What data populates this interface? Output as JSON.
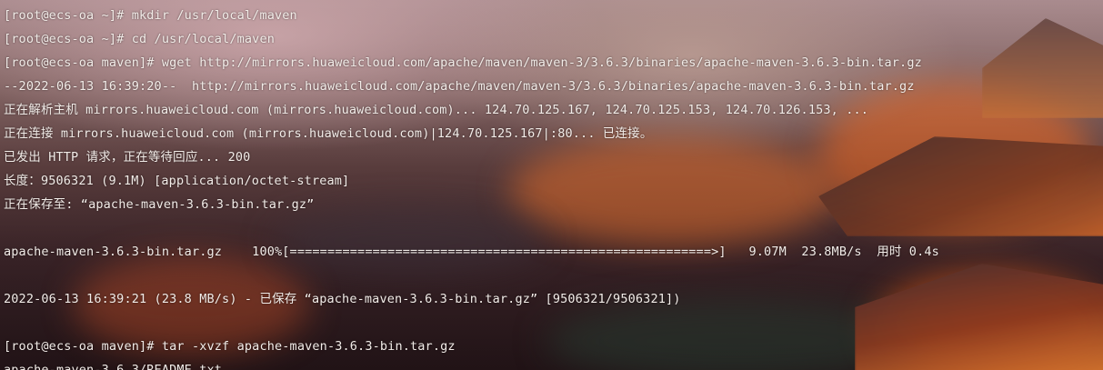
{
  "terminal": {
    "lines": [
      "[root@ecs-oa ~]# mkdir /usr/local/maven",
      "[root@ecs-oa ~]# cd /usr/local/maven",
      "[root@ecs-oa maven]# wget http://mirrors.huaweicloud.com/apache/maven/maven-3/3.6.3/binaries/apache-maven-3.6.3-bin.tar.gz",
      "--2022-06-13 16:39:20--  http://mirrors.huaweicloud.com/apache/maven/maven-3/3.6.3/binaries/apache-maven-3.6.3-bin.tar.gz",
      "正在解析主机 mirrors.huaweicloud.com (mirrors.huaweicloud.com)... 124.70.125.167, 124.70.125.153, 124.70.126.153, ...",
      "正在连接 mirrors.huaweicloud.com (mirrors.huaweicloud.com)|124.70.125.167|:80... 已连接。",
      "已发出 HTTP 请求，正在等待回应... 200",
      "长度：9506321 (9.1M) [application/octet-stream]",
      "正在保存至: “apache-maven-3.6.3-bin.tar.gz”",
      "",
      "apache-maven-3.6.3-bin.tar.gz    100%[========================================================>]   9.07M  23.8MB/s  用时 0.4s",
      "",
      "2022-06-13 16:39:21 (23.8 MB/s) - 已保存 “apache-maven-3.6.3-bin.tar.gz” [9506321/9506321])",
      "",
      "[root@ecs-oa maven]# tar -xvzf apache-maven-3.6.3-bin.tar.gz",
      "apache-maven-3.6.3/README.txt"
    ]
  },
  "colors": {
    "text": "#f2ece8",
    "glow": "#ff7a1c"
  }
}
